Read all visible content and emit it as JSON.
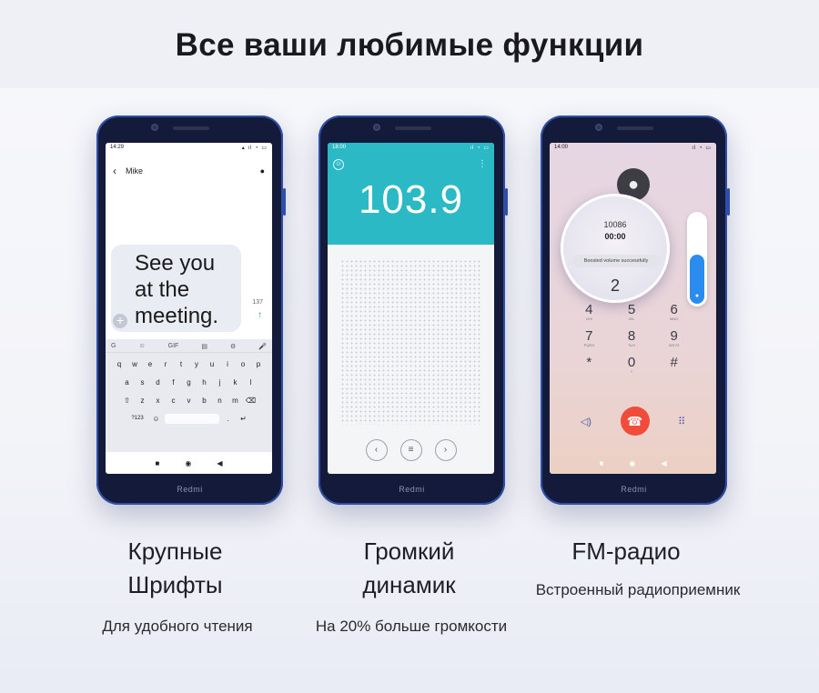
{
  "page": {
    "title": "Все ваши любимые функции"
  },
  "phones": {
    "brand": "Redmi",
    "messages": {
      "status_time": "14:29",
      "contact": "Mike",
      "message_lines": [
        "See you",
        "at the",
        "meeting."
      ],
      "char_count": "137",
      "keyboard": {
        "toolbar": [
          "G",
          "☺",
          "GIF",
          "▤",
          "⚙",
          "🎤"
        ],
        "row1": [
          "q",
          "w",
          "e",
          "r",
          "t",
          "y",
          "u",
          "i",
          "o",
          "p"
        ],
        "row2": [
          "a",
          "s",
          "d",
          "f",
          "g",
          "h",
          "j",
          "k",
          "l"
        ],
        "row3": [
          "⇧",
          "z",
          "x",
          "c",
          "v",
          "b",
          "n",
          "m",
          "⌫"
        ],
        "row4_left": "?123",
        "row4_right": "↵"
      }
    },
    "radio": {
      "status_time": "18:00",
      "frequency": "103.9"
    },
    "call": {
      "status_time": "14:00",
      "number": "10086",
      "duration": "00:00",
      "toast": "Boosted volume successfully",
      "magnified_digit": "2",
      "volume_level": 0.55,
      "dialpad": [
        {
          "digit": "4",
          "letters": "GHI"
        },
        {
          "digit": "5",
          "letters": "JKL"
        },
        {
          "digit": "6",
          "letters": "MNO"
        },
        {
          "digit": "7",
          "letters": "PQRS"
        },
        {
          "digit": "8",
          "letters": "TUV"
        },
        {
          "digit": "9",
          "letters": "WXYZ"
        },
        {
          "digit": "*",
          "letters": ""
        },
        {
          "digit": "0",
          "letters": "+"
        },
        {
          "digit": "#",
          "letters": ""
        }
      ]
    }
  },
  "features": [
    {
      "title_line1": "Крупные",
      "title_line2": "Шрифты",
      "subtitle": "Для удобного чтения"
    },
    {
      "title_line1": "Громкий",
      "title_line2": "динамик",
      "subtitle": "На 20% больше громкости"
    },
    {
      "title_line1": "FM-радио",
      "title_line2": "",
      "subtitle": "Встроенный радиоприемник"
    }
  ]
}
